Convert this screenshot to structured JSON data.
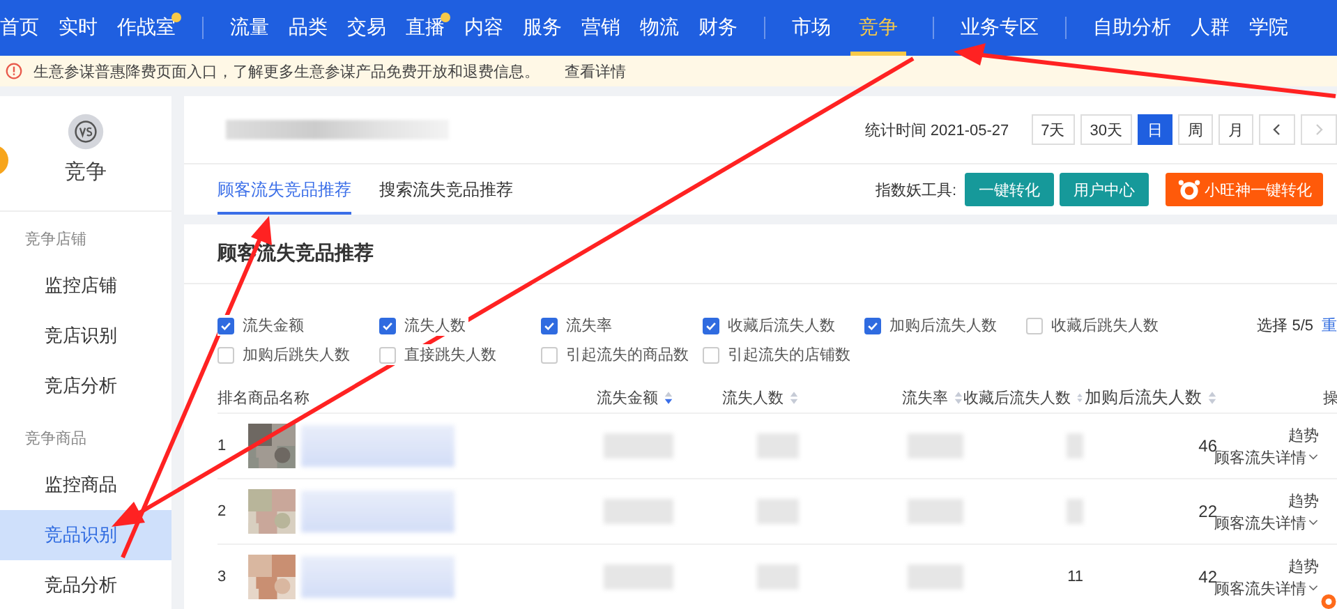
{
  "nav": {
    "groups": [
      [
        {
          "label": "首页",
          "selected": false,
          "badge": false
        },
        {
          "label": "实时",
          "selected": false,
          "badge": false
        },
        {
          "label": "作战室",
          "selected": false,
          "badge": true
        }
      ],
      [
        {
          "label": "流量",
          "selected": false,
          "badge": false
        },
        {
          "label": "品类",
          "selected": false,
          "badge": false
        },
        {
          "label": "交易",
          "selected": false,
          "badge": false
        },
        {
          "label": "直播",
          "selected": false,
          "badge": true
        },
        {
          "label": "内容",
          "selected": false,
          "badge": false
        },
        {
          "label": "服务",
          "selected": false,
          "badge": false
        },
        {
          "label": "营销",
          "selected": false,
          "badge": false
        },
        {
          "label": "物流",
          "selected": false,
          "badge": false
        },
        {
          "label": "财务",
          "selected": false,
          "badge": false
        }
      ],
      [
        {
          "label": "市场",
          "selected": false,
          "badge": false
        },
        {
          "label": "竞争",
          "selected": true,
          "badge": false
        }
      ],
      [
        {
          "label": "业务专区",
          "selected": false,
          "badge": false
        }
      ],
      [
        {
          "label": "自助分析",
          "selected": false,
          "badge": false
        },
        {
          "label": "人群",
          "selected": false,
          "badge": false
        },
        {
          "label": "学院",
          "selected": false,
          "badge": false
        }
      ]
    ]
  },
  "notice": {
    "text": "生意参谋普惠降费页面入口，了解更多生意参谋产品免费开放和退费信息。",
    "link": "查看详情"
  },
  "sidebar": {
    "title": "竞争",
    "sections": [
      {
        "heading": "竞争店铺",
        "items": [
          {
            "label": "监控店铺",
            "selected": false
          },
          {
            "label": "竞店识别",
            "selected": false
          },
          {
            "label": "竞店分析",
            "selected": false
          }
        ]
      },
      {
        "heading": "竞争商品",
        "items": [
          {
            "label": "监控商品",
            "selected": false
          },
          {
            "label": "竞品识别",
            "selected": true
          },
          {
            "label": "竞品分析",
            "selected": false
          }
        ]
      }
    ]
  },
  "header": {
    "stat_time": "统计时间 2021-05-27",
    "periods": [
      {
        "label": "7天",
        "selected": false
      },
      {
        "label": "30天",
        "selected": false
      },
      {
        "label": "日",
        "selected": true
      },
      {
        "label": "周",
        "selected": false
      },
      {
        "label": "月",
        "selected": false
      }
    ],
    "next_disabled": true
  },
  "tabs": [
    {
      "label": "顾客流失竞品推荐",
      "selected": true
    },
    {
      "label": "搜索流失竞品推荐",
      "selected": false
    }
  ],
  "tools": {
    "label": "指数妖工具:",
    "buttons": [
      "一键转化",
      "用户中心"
    ],
    "promo": "小旺神一键转化"
  },
  "section_title": "顾客流失竞品推荐",
  "metrics": [
    {
      "label": "流失金额",
      "checked": true
    },
    {
      "label": "流失人数",
      "checked": true
    },
    {
      "label": "流失率",
      "checked": true
    },
    {
      "label": "收藏后流失人数",
      "checked": true
    },
    {
      "label": "加购后流失人数",
      "checked": true
    },
    {
      "label": "收藏后跳失人数",
      "checked": false
    },
    {
      "label": "加购后跳失人数",
      "checked": false
    },
    {
      "label": "直接跳失人数",
      "checked": false
    },
    {
      "label": "引起流失的商品数",
      "checked": false
    },
    {
      "label": "引起流失的店铺数",
      "checked": false
    }
  ],
  "selection": {
    "count": "选择 5/5",
    "reset": "重"
  },
  "table": {
    "columns": [
      {
        "label": "排名"
      },
      {
        "label": "商品名称"
      },
      {
        "label": "流失金额",
        "sort_active": true
      },
      {
        "label": "流失人数",
        "sort_active": false
      },
      {
        "label": "流失率",
        "sort_active": false
      },
      {
        "label": "收藏后流失人数",
        "sort_active": false
      },
      {
        "label": "加购后流失人数",
        "sort_active": false
      },
      {
        "label": "操"
      }
    ],
    "rows": [
      {
        "rank": "1",
        "collect_lost": null,
        "cart_lost": "46",
        "actions": [
          "趋势",
          "顾客流失详情"
        ]
      },
      {
        "rank": "2",
        "collect_lost": null,
        "cart_lost": "22",
        "actions": [
          "趋势",
          "顾客流失详情"
        ]
      },
      {
        "rank": "3",
        "collect_lost": "11",
        "cart_lost": "42",
        "actions": [
          "趋势",
          "顾客流失详情"
        ]
      }
    ]
  }
}
